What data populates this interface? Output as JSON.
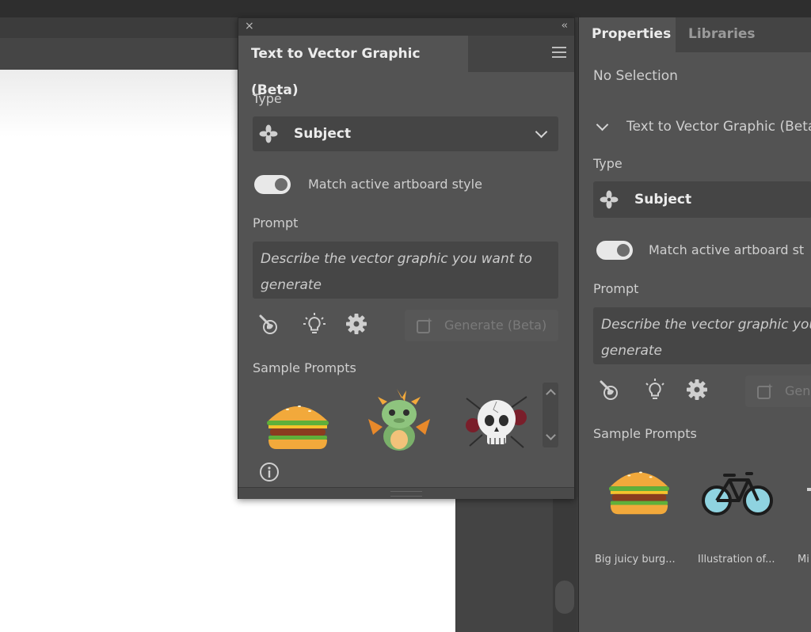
{
  "float_panel": {
    "close_glyph": "×",
    "collapse_glyph": "‹‹",
    "tab_title": "Text to Vector Graphic (Beta)",
    "type_label": "Type",
    "type_value": "Subject",
    "match_style_label": "Match active artboard style",
    "match_style_on": true,
    "prompt_label": "Prompt",
    "prompt_placeholder_line1": "Describe the vector graphic you want to",
    "prompt_placeholder_line2": "generate",
    "generate_label": "Generate (Beta)",
    "sample_prompts_label": "Sample Prompts",
    "sample_icons": [
      "burger-image",
      "dragon-image",
      "skull-image"
    ]
  },
  "props_panel": {
    "tabs": [
      "Properties",
      "Libraries"
    ],
    "no_selection": "No Selection",
    "section_title": "Text to Vector Graphic (Beta",
    "type_label": "Type",
    "type_value": "Subject",
    "match_style_label": "Match active artboard st",
    "prompt_label": "Prompt",
    "prompt_placeholder_line1": "Describe the vector graphic you w",
    "prompt_placeholder_line2": "generate",
    "generate_label": "Gen",
    "sample_prompts_label": "Sample Prompts",
    "samples": [
      {
        "caption": "Big juicy burg...",
        "icon": "burger-image"
      },
      {
        "caption": "Illustration of...",
        "icon": "bicycle-image"
      },
      {
        "caption": "Mi",
        "icon": "partial-image"
      }
    ]
  },
  "colors": {
    "panel_bg": "#535353",
    "panel_dark": "#444444",
    "artboard": "#ffffff",
    "toggle_on": "#e8e8e8"
  }
}
